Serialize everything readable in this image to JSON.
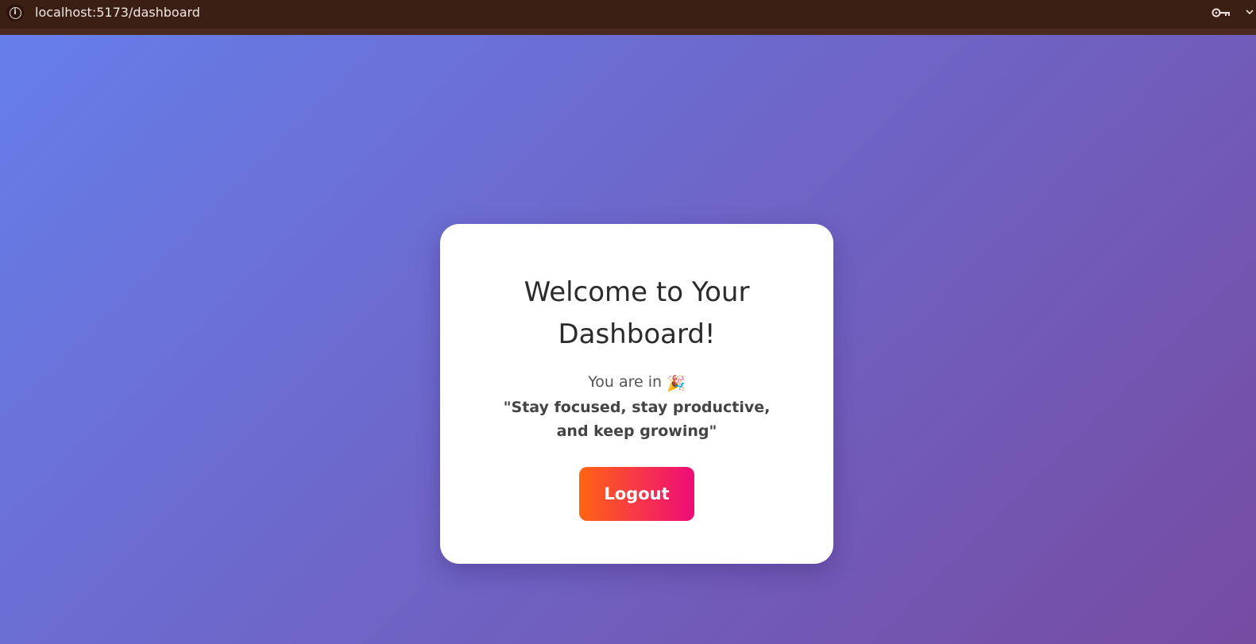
{
  "browser": {
    "url": "localhost:5173/dashboard",
    "info_icon": "info-icon",
    "key_icon": "key-icon",
    "chevron_icon": "chevron-down-icon"
  },
  "dashboard": {
    "title": "Welcome to Your Dashboard!",
    "welcome_text": "You are in",
    "welcome_emoji": "🎉",
    "quote": "\"Stay focused, stay productive, and keep growing\"",
    "logout_label": "Logout"
  },
  "colors": {
    "background_gradient_start": "#667eea",
    "background_gradient_end": "#764ba2",
    "button_gradient_start": "#ff6413",
    "button_gradient_end": "#ee0c79",
    "card_background": "#ffffff"
  }
}
